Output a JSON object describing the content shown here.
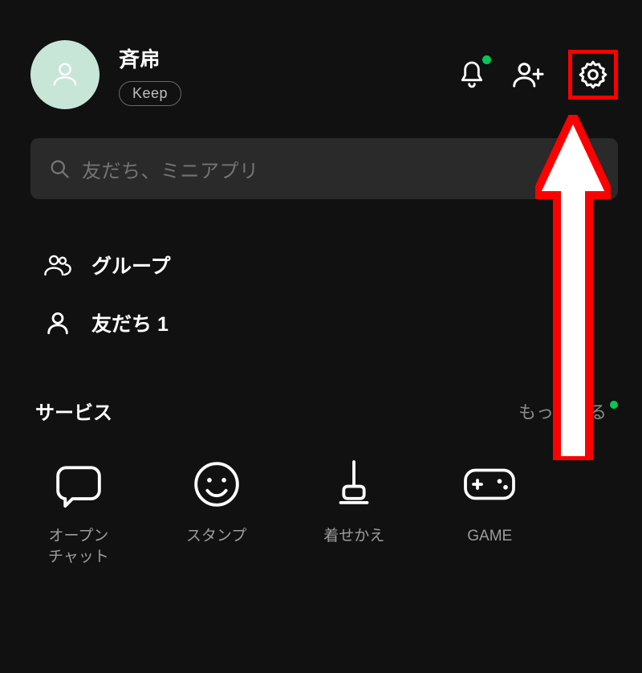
{
  "profile": {
    "username": "斉帍",
    "keep_label": "Keep"
  },
  "search": {
    "placeholder": "友だち、ミニアプリ"
  },
  "nav": {
    "group_label": "グループ",
    "friends_label": "友だち 1"
  },
  "services_section": {
    "title": "サービス",
    "more_label": "もっと見る"
  },
  "services": [
    {
      "label": "オープン\nチャット"
    },
    {
      "label": "スタンプ"
    },
    {
      "label": "着せかえ"
    },
    {
      "label": "GAME"
    }
  ],
  "colors": {
    "accent": "#06c755",
    "highlight": "#ff0000"
  }
}
